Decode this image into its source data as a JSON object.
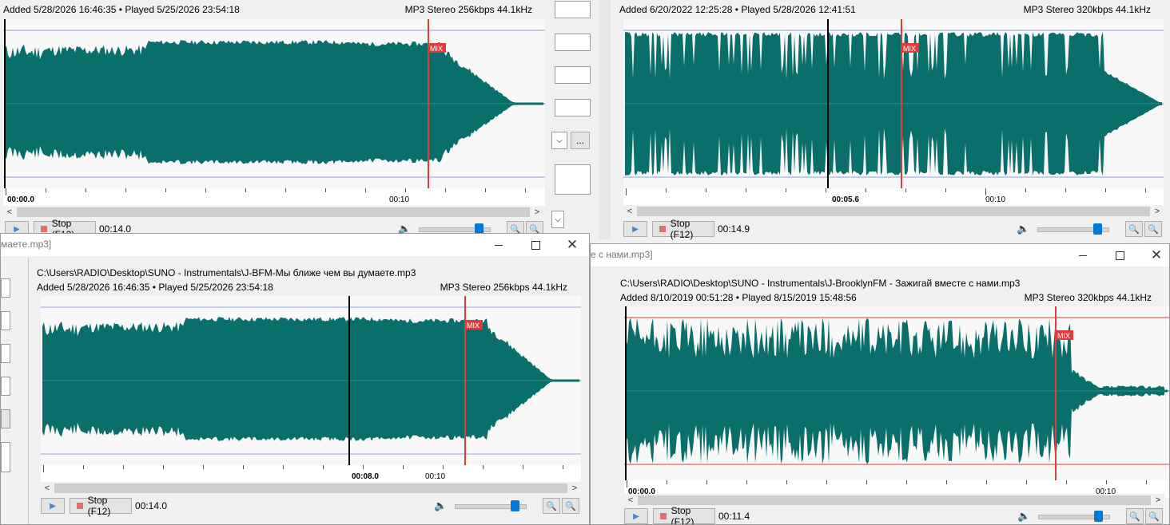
{
  "windows": [
    {
      "id": "w1",
      "added": "Added 5/28/2026 16:46:35 • Played 5/25/2026 23:54:18",
      "format": "MP3 Stereo 256kbps 44.1kHz",
      "pos_label": "00:00.0",
      "tick_label": "00:10",
      "stop_label": "Stop (F12)",
      "time": "00:14.0",
      "mix": "MIX"
    },
    {
      "id": "w2",
      "added": "Added 6/20/2022 12:25:28 • Played 5/28/2026 12:41:51",
      "format": "MP3 Stereo 320kbps 44.1kHz",
      "pos_label": "00:05.6",
      "tick_label": "00:10",
      "stop_label": "Stop (F12)",
      "time": "00:14.9",
      "mix": "MIX"
    },
    {
      "id": "w3",
      "title": "маете.mp3]",
      "path": "C:\\Users\\RADIO\\Desktop\\SUNO - Instrumentals\\J-BFM-Мы ближе чем вы думаете.mp3",
      "added": "Added 5/28/2026 16:46:35 • Played 5/25/2026 23:54:18",
      "format": "MP3 Stereo 256kbps 44.1kHz",
      "pos_label": "00:08.0",
      "tick_label": "00:10",
      "stop_label": "Stop (F12)",
      "time": "00:14.0",
      "mix": "MIX"
    },
    {
      "id": "w4",
      "title": "е с нами.mp3]",
      "path": "C:\\Users\\RADIO\\Desktop\\SUNO - Instrumentals\\J-BrooklynFM - Зажигай вместе с нами.mp3",
      "added": "Added 8/10/2019 00:51:28 • Played 8/15/2019 15:48:56",
      "format": "MP3 Stereo 320kbps 44.1kHz",
      "pos_label": "00:00.0",
      "tick_label": "00:10",
      "stop_label": "Stop (F12)",
      "time": "00:11.4",
      "mix": "MIX"
    }
  ],
  "buttons": {
    "browse": "..."
  },
  "icons": {
    "play": "play-icon",
    "stop": "stop-icon",
    "volume": "speaker-icon",
    "zoom_out": "zoom-out-icon",
    "zoom_in": "zoom-in-icon",
    "minimize": "minimize-icon",
    "maximize": "maximize-icon",
    "close": "close-icon"
  },
  "colors": {
    "wave": "#0a6e6a",
    "mix_marker": "#e03c3c",
    "cursor": "#000000",
    "guide_blue": "#8ca4d8"
  }
}
